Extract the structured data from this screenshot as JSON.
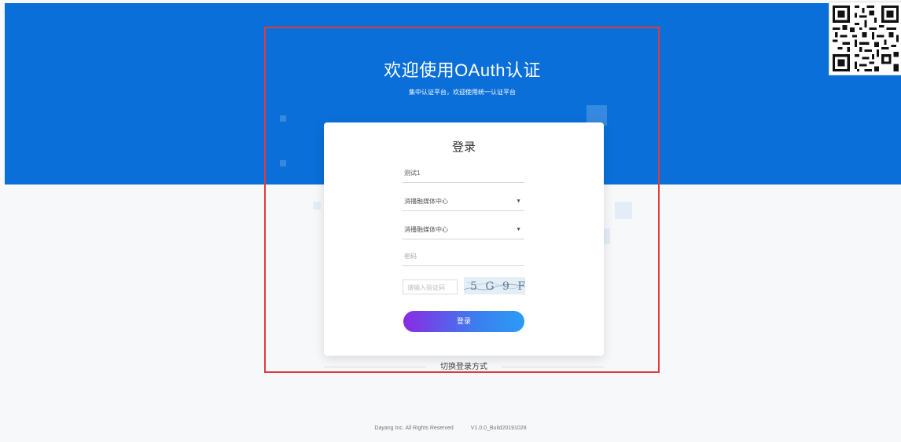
{
  "hero": {
    "title": "欢迎使用OAuth认证",
    "subtitle": "集中认证平台，欢迎使用统一认证平台",
    "bg_color": "#0a6fd8"
  },
  "login_card": {
    "title": "登录",
    "username_value": "测试1",
    "org_select_1": "消播融媒体中心",
    "org_select_2": "消播融媒体中心",
    "password_placeholder": "密码",
    "captcha_placeholder": "请输入验证码",
    "captcha_text": "5 G 9 F",
    "submit_label": "登录"
  },
  "switch_login": {
    "label": "切换登录方式"
  },
  "footer": {
    "copyright": "Dayang Inc. All Rights Reserved",
    "version": "V1.0.0_Build20191028"
  },
  "qr_code": {
    "icon": "qr-code-icon"
  },
  "highlight_color": "#e23a3a"
}
